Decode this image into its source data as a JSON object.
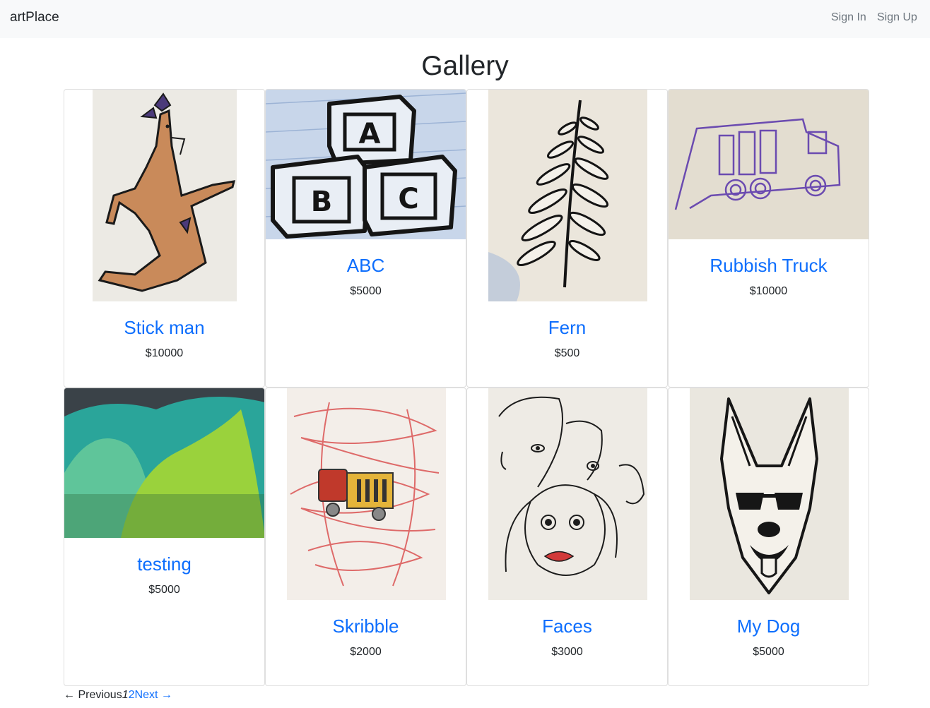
{
  "navbar": {
    "brand": "artPlace",
    "sign_in": "Sign In",
    "sign_up": "Sign Up"
  },
  "page": {
    "title": "Gallery"
  },
  "gallery": [
    {
      "title": "Stick man",
      "price": "$10000",
      "image": "stick-man-drawing"
    },
    {
      "title": "ABC",
      "price": "$5000",
      "image": "abc-blocks-drawing"
    },
    {
      "title": "Fern",
      "price": "$500",
      "image": "fern-drawing"
    },
    {
      "title": "Rubbish Truck",
      "price": "$10000",
      "image": "rubbish-truck-drawing"
    },
    {
      "title": "testing",
      "price": "$5000",
      "image": "green-hills-photo"
    },
    {
      "title": "Skribble",
      "price": "$2000",
      "image": "scribble-sticker-drawing"
    },
    {
      "title": "Faces",
      "price": "$3000",
      "image": "faces-drawing"
    },
    {
      "title": "My Dog",
      "price": "$5000",
      "image": "dog-sunglasses-drawing"
    }
  ],
  "pagination": {
    "previous": "← Previous",
    "page1": "1",
    "page2": "2",
    "next": "Next →"
  },
  "colors": {
    "link": "#0d6efd",
    "navbar_bg": "#f8f9fa",
    "muted": "#6c757d"
  }
}
